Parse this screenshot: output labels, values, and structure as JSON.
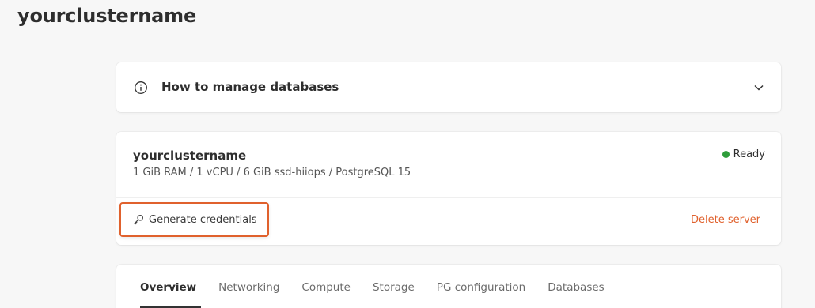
{
  "header": {
    "title": "yourclustername"
  },
  "accordion": {
    "title": "How to manage databases",
    "icon": "info-icon",
    "toggle_icon": "chevron-down-icon"
  },
  "server": {
    "name": "yourclustername",
    "specs": "1 GiB RAM / 1 vCPU / 6 GiB ssd-hiiops / PostgreSQL 15",
    "status": {
      "label": "Ready",
      "color": "#2e9d3a"
    },
    "actions": {
      "generate_label": "Generate credentials",
      "generate_icon": "key-icon",
      "delete_label": "Delete server"
    }
  },
  "tabs": [
    {
      "label": "Overview",
      "active": true
    },
    {
      "label": "Networking",
      "active": false
    },
    {
      "label": "Compute",
      "active": false
    },
    {
      "label": "Storage",
      "active": false
    },
    {
      "label": "PG configuration",
      "active": false
    },
    {
      "label": "Databases",
      "active": false
    }
  ],
  "colors": {
    "accent": "#e0612d",
    "ready": "#2e9d3a",
    "background": "#f7f7f7"
  }
}
